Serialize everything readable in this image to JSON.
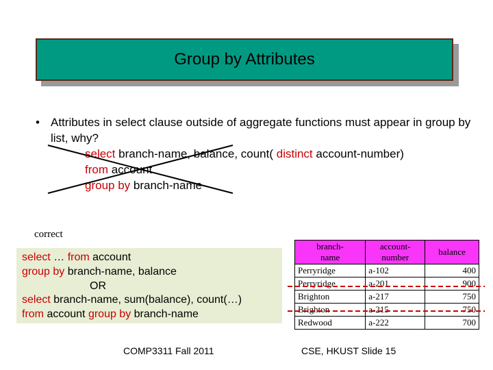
{
  "title": "Group by Attributes",
  "bullet": {
    "text": "Attributes in select clause outside of aggregate functions must appear in group by list, why?"
  },
  "sql_wrong": {
    "l1_pre": "select",
    "l1_mid1": " branch-name, ",
    "l1_bal": "balance",
    "l1_mid2": ", count( ",
    "l1_dist": "distinct",
    "l1_end": " account-number)",
    "l2_pre": "from",
    "l2_end": " account",
    "l3_pre": "group by",
    "l3_end": " branch-name"
  },
  "correct_label": "correct",
  "correct_box": {
    "l1a": "select",
    "l1b": " … ",
    "l1c": "from",
    "l1d": " account",
    "l2a": "group by",
    "l2b": " branch-name, balance",
    "or": "OR",
    "l3a": "select",
    "l3b": " branch-name, sum(balance), count(…)",
    "l4a": "from",
    "l4b": " account  ",
    "l4c": "group by",
    "l4d": " branch-name"
  },
  "table": {
    "headers": [
      "branch-\nname",
      "account-\nnumber",
      "balance"
    ],
    "rows": [
      [
        "Perryridge",
        "a-102",
        "400"
      ],
      [
        "Perryridge",
        "a-201",
        "900"
      ],
      [
        "Brighton",
        "a-217",
        "750"
      ],
      [
        "Brighton",
        "a-215",
        "750"
      ],
      [
        "Redwood",
        "a-222",
        "700"
      ]
    ]
  },
  "footer": {
    "left": "COMP3311 Fall 2011",
    "right": "CSE, HKUST   Slide 15"
  }
}
